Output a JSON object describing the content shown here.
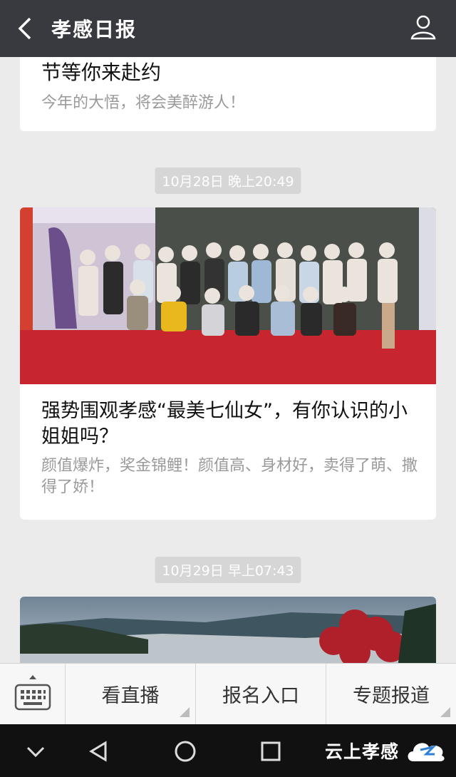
{
  "header": {
    "title": "孝感日报",
    "back_icon": "back-arrow-icon",
    "profile_icon": "person-icon"
  },
  "feed": {
    "card1": {
      "headline_tail": "节等你来赴约",
      "description": "今年的大悟，将会美醉游人！"
    },
    "timestamp1": "10月28日 晚上20:49",
    "card2": {
      "headline": "强势围观孝感“最美七仙女”，有你认识的小姐姐吗？",
      "description": "颜值爆炸，奖金锦鲤！颜值高、身材好，卖得了萌、撒得了娇！"
    },
    "timestamp2": "10月29日 早上07:43"
  },
  "menu": {
    "keyboard_icon": "keyboard-icon",
    "items": [
      {
        "label": "看直播"
      },
      {
        "label": "报名入口"
      },
      {
        "label": "专题报道"
      }
    ]
  },
  "navbar": {
    "icons": [
      "chevron-down-icon",
      "back-triangle-icon",
      "home-circle-icon",
      "recents-square-icon"
    ],
    "brand": "云上孝感"
  },
  "colors": {
    "header_bg": "#393a3f",
    "page_bg": "#ebebeb",
    "timestamp_bg": "#d6d6d6",
    "stage_red": "#c8262e"
  }
}
